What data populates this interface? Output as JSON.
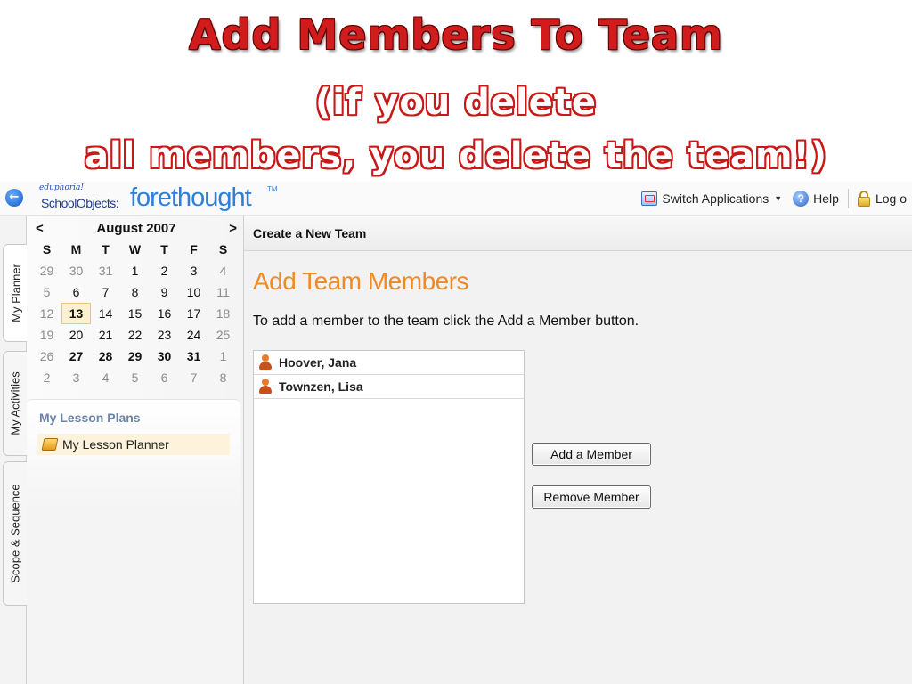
{
  "slide": {
    "title": "Add Members To Team",
    "subtitle_line1": "(if you delete",
    "subtitle_line2": "all members, you delete the team!)"
  },
  "topbar": {
    "logo_edu": "eduphoria!",
    "logo_schoolobjects": "SchoolObjects:",
    "logo_forethought": "forethought",
    "logo_tm": "TM",
    "switch_label": "Switch Applications",
    "help_label": "Help",
    "logout_label": "Log o"
  },
  "tabs": [
    {
      "label": "My Planner",
      "active": true
    },
    {
      "label": "My Activities",
      "active": false
    },
    {
      "label": "Scope & Sequence",
      "active": false
    }
  ],
  "calendar": {
    "prev": "<",
    "next": ">",
    "month": "August 2007",
    "days_of_week": [
      "S",
      "M",
      "T",
      "W",
      "T",
      "F",
      "S"
    ],
    "weeks": [
      [
        {
          "d": "29",
          "t": "other"
        },
        {
          "d": "30",
          "t": "other"
        },
        {
          "d": "31",
          "t": "other"
        },
        {
          "d": "1",
          "t": ""
        },
        {
          "d": "2",
          "t": ""
        },
        {
          "d": "3",
          "t": ""
        },
        {
          "d": "4",
          "t": "other"
        }
      ],
      [
        {
          "d": "5",
          "t": "other"
        },
        {
          "d": "6",
          "t": ""
        },
        {
          "d": "7",
          "t": ""
        },
        {
          "d": "8",
          "t": ""
        },
        {
          "d": "9",
          "t": ""
        },
        {
          "d": "10",
          "t": ""
        },
        {
          "d": "11",
          "t": "other"
        }
      ],
      [
        {
          "d": "12",
          "t": "other"
        },
        {
          "d": "13",
          "t": "today"
        },
        {
          "d": "14",
          "t": ""
        },
        {
          "d": "15",
          "t": ""
        },
        {
          "d": "16",
          "t": ""
        },
        {
          "d": "17",
          "t": ""
        },
        {
          "d": "18",
          "t": "other"
        }
      ],
      [
        {
          "d": "19",
          "t": "other"
        },
        {
          "d": "20",
          "t": ""
        },
        {
          "d": "21",
          "t": ""
        },
        {
          "d": "22",
          "t": ""
        },
        {
          "d": "23",
          "t": ""
        },
        {
          "d": "24",
          "t": ""
        },
        {
          "d": "25",
          "t": "other"
        }
      ],
      [
        {
          "d": "26",
          "t": "other"
        },
        {
          "d": "27",
          "t": "bold"
        },
        {
          "d": "28",
          "t": "bold"
        },
        {
          "d": "29",
          "t": "bold"
        },
        {
          "d": "30",
          "t": "bold"
        },
        {
          "d": "31",
          "t": "bold"
        },
        {
          "d": "1",
          "t": "other"
        }
      ],
      [
        {
          "d": "2",
          "t": "other"
        },
        {
          "d": "3",
          "t": "other"
        },
        {
          "d": "4",
          "t": "other"
        },
        {
          "d": "5",
          "t": "other"
        },
        {
          "d": "6",
          "t": "other"
        },
        {
          "d": "7",
          "t": "other"
        },
        {
          "d": "8",
          "t": "other"
        }
      ]
    ]
  },
  "lesson_plans": {
    "title": "My Lesson Plans",
    "item": "My Lesson Planner"
  },
  "main": {
    "header": "Create a New Team",
    "title": "Add Team Members",
    "instruction": "To add a member to the team click the Add a Member button.",
    "members": [
      "Hoover, Jana",
      "Townzen, Lisa"
    ],
    "add_button": "Add a Member",
    "remove_button": "Remove Member"
  },
  "colors": {
    "slide_title": "#d01c1c",
    "main_title": "#f08a24",
    "section_title": "#6b84a6",
    "logo_blue": "#2f7ed8"
  }
}
